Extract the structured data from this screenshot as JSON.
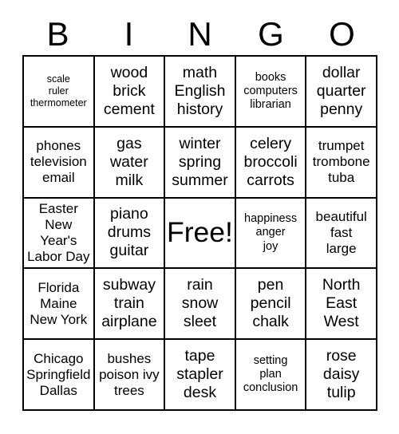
{
  "card": {
    "header_letters": [
      "B",
      "I",
      "N",
      "G",
      "O"
    ],
    "free_space_label": "Free!",
    "rows": [
      [
        {
          "lines": [
            "scale",
            "ruler",
            "thermometer"
          ],
          "size": "xs"
        },
        {
          "lines": [
            "wood",
            "brick",
            "cement"
          ],
          "size": "l"
        },
        {
          "lines": [
            "math",
            "English",
            "history"
          ],
          "size": "l"
        },
        {
          "lines": [
            "books",
            "computers",
            "librarian"
          ],
          "size": "s"
        },
        {
          "lines": [
            "dollar",
            "quarter",
            "penny"
          ],
          "size": "l"
        }
      ],
      [
        {
          "lines": [
            "phones",
            "television",
            "email"
          ],
          "size": "m"
        },
        {
          "lines": [
            "gas",
            "water",
            "milk"
          ],
          "size": "l"
        },
        {
          "lines": [
            "winter",
            "spring",
            "summer"
          ],
          "size": "l"
        },
        {
          "lines": [
            "celery",
            "broccoli",
            "carrots"
          ],
          "size": "l"
        },
        {
          "lines": [
            "trumpet",
            "trombone",
            "tuba"
          ],
          "size": "m"
        }
      ],
      [
        {
          "lines": [
            "Easter",
            "New",
            "Year's",
            "Labor Day"
          ],
          "size": "m"
        },
        {
          "lines": [
            "piano",
            "drums",
            "guitar"
          ],
          "size": "l"
        },
        {
          "lines": [
            "Free!"
          ],
          "size": "free"
        },
        {
          "lines": [
            "happiness",
            "anger",
            "joy"
          ],
          "size": "s"
        },
        {
          "lines": [
            "beautiful",
            "fast",
            "large"
          ],
          "size": "m"
        }
      ],
      [
        {
          "lines": [
            "Florida",
            "Maine",
            "New York"
          ],
          "size": "m"
        },
        {
          "lines": [
            "subway",
            "train",
            "airplane"
          ],
          "size": "l"
        },
        {
          "lines": [
            "rain",
            "snow",
            "sleet"
          ],
          "size": "l"
        },
        {
          "lines": [
            "pen",
            "pencil",
            "chalk"
          ],
          "size": "l"
        },
        {
          "lines": [
            "North",
            "East",
            "West"
          ],
          "size": "l"
        }
      ],
      [
        {
          "lines": [
            "Chicago",
            "Springfield",
            "Dallas"
          ],
          "size": "m"
        },
        {
          "lines": [
            "bushes",
            "poison ivy",
            "trees"
          ],
          "size": "m"
        },
        {
          "lines": [
            "tape",
            "stapler",
            "desk"
          ],
          "size": "l"
        },
        {
          "lines": [
            "setting",
            "plan",
            "conclusion"
          ],
          "size": "s"
        },
        {
          "lines": [
            "rose",
            "daisy",
            "tulip"
          ],
          "size": "l"
        }
      ]
    ]
  },
  "colors": {
    "background": "#ffffff",
    "text": "#000000",
    "grid_line": "#000000"
  }
}
